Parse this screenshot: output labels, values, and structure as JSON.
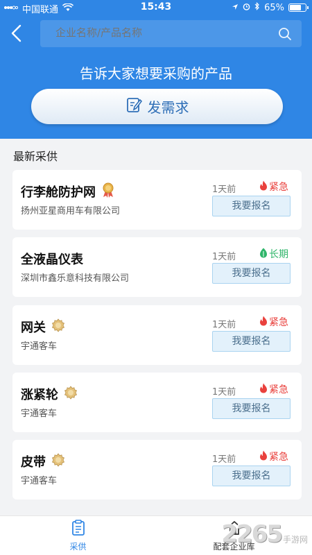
{
  "status_bar": {
    "carrier": "中国联通",
    "time": "15:43",
    "battery": "65%",
    "battery_level": 0.65
  },
  "header": {
    "search_placeholder": "企业名称/产品名称",
    "headline": "告诉大家想要采购的产品",
    "post_button_label": "发需求"
  },
  "section_title": "最新采供",
  "cards": [
    {
      "title": "行李舱防护网",
      "badge": "award-ribbon-icon",
      "company": "扬州亚星商用车有限公司",
      "time": "1天前",
      "tag": "紧急",
      "tag_type": "urgent",
      "button": "我要报名"
    },
    {
      "title": "全液晶仪表",
      "badge": "",
      "company": "深圳市鑫乐意科技有限公司",
      "time": "1天前",
      "tag": "长期",
      "tag_type": "long",
      "button": "我要报名"
    },
    {
      "title": "网关",
      "badge": "gold-seal-icon",
      "company": "宇通客车",
      "time": "1天前",
      "tag": "紧急",
      "tag_type": "urgent",
      "button": "我要报名"
    },
    {
      "title": "涨紧轮",
      "badge": "gold-seal-icon",
      "company": "宇通客车",
      "time": "1天前",
      "tag": "紧急",
      "tag_type": "urgent",
      "button": "我要报名"
    },
    {
      "title": "皮带",
      "badge": "gold-seal-icon",
      "company": "宇通客车",
      "time": "1天前",
      "tag": "紧急",
      "tag_type": "urgent",
      "button": "我要报名"
    }
  ],
  "tabbar": {
    "tabs": [
      {
        "label": "采供",
        "icon": "clipboard-icon",
        "active": true
      },
      {
        "label": "配套企业库",
        "icon": "home-icon",
        "active": false
      }
    ]
  },
  "watermark": {
    "number": "2265",
    "text": "手游网"
  },
  "colors": {
    "primary": "#2f86e5",
    "urgent": "#e9413d",
    "long_term": "#2fb56a",
    "button_bg": "#e3f1fb"
  }
}
